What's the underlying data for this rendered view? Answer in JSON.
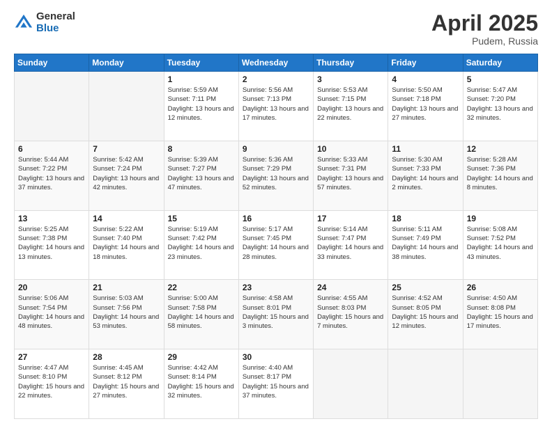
{
  "header": {
    "logo_general": "General",
    "logo_blue": "Blue",
    "title": "April 2025",
    "location": "Pudem, Russia"
  },
  "weekdays": [
    "Sunday",
    "Monday",
    "Tuesday",
    "Wednesday",
    "Thursday",
    "Friday",
    "Saturday"
  ],
  "weeks": [
    [
      {
        "day": "",
        "info": ""
      },
      {
        "day": "",
        "info": ""
      },
      {
        "day": "1",
        "info": "Sunrise: 5:59 AM\nSunset: 7:11 PM\nDaylight: 13 hours and 12 minutes."
      },
      {
        "day": "2",
        "info": "Sunrise: 5:56 AM\nSunset: 7:13 PM\nDaylight: 13 hours and 17 minutes."
      },
      {
        "day": "3",
        "info": "Sunrise: 5:53 AM\nSunset: 7:15 PM\nDaylight: 13 hours and 22 minutes."
      },
      {
        "day": "4",
        "info": "Sunrise: 5:50 AM\nSunset: 7:18 PM\nDaylight: 13 hours and 27 minutes."
      },
      {
        "day": "5",
        "info": "Sunrise: 5:47 AM\nSunset: 7:20 PM\nDaylight: 13 hours and 32 minutes."
      }
    ],
    [
      {
        "day": "6",
        "info": "Sunrise: 5:44 AM\nSunset: 7:22 PM\nDaylight: 13 hours and 37 minutes."
      },
      {
        "day": "7",
        "info": "Sunrise: 5:42 AM\nSunset: 7:24 PM\nDaylight: 13 hours and 42 minutes."
      },
      {
        "day": "8",
        "info": "Sunrise: 5:39 AM\nSunset: 7:27 PM\nDaylight: 13 hours and 47 minutes."
      },
      {
        "day": "9",
        "info": "Sunrise: 5:36 AM\nSunset: 7:29 PM\nDaylight: 13 hours and 52 minutes."
      },
      {
        "day": "10",
        "info": "Sunrise: 5:33 AM\nSunset: 7:31 PM\nDaylight: 13 hours and 57 minutes."
      },
      {
        "day": "11",
        "info": "Sunrise: 5:30 AM\nSunset: 7:33 PM\nDaylight: 14 hours and 2 minutes."
      },
      {
        "day": "12",
        "info": "Sunrise: 5:28 AM\nSunset: 7:36 PM\nDaylight: 14 hours and 8 minutes."
      }
    ],
    [
      {
        "day": "13",
        "info": "Sunrise: 5:25 AM\nSunset: 7:38 PM\nDaylight: 14 hours and 13 minutes."
      },
      {
        "day": "14",
        "info": "Sunrise: 5:22 AM\nSunset: 7:40 PM\nDaylight: 14 hours and 18 minutes."
      },
      {
        "day": "15",
        "info": "Sunrise: 5:19 AM\nSunset: 7:42 PM\nDaylight: 14 hours and 23 minutes."
      },
      {
        "day": "16",
        "info": "Sunrise: 5:17 AM\nSunset: 7:45 PM\nDaylight: 14 hours and 28 minutes."
      },
      {
        "day": "17",
        "info": "Sunrise: 5:14 AM\nSunset: 7:47 PM\nDaylight: 14 hours and 33 minutes."
      },
      {
        "day": "18",
        "info": "Sunrise: 5:11 AM\nSunset: 7:49 PM\nDaylight: 14 hours and 38 minutes."
      },
      {
        "day": "19",
        "info": "Sunrise: 5:08 AM\nSunset: 7:52 PM\nDaylight: 14 hours and 43 minutes."
      }
    ],
    [
      {
        "day": "20",
        "info": "Sunrise: 5:06 AM\nSunset: 7:54 PM\nDaylight: 14 hours and 48 minutes."
      },
      {
        "day": "21",
        "info": "Sunrise: 5:03 AM\nSunset: 7:56 PM\nDaylight: 14 hours and 53 minutes."
      },
      {
        "day": "22",
        "info": "Sunrise: 5:00 AM\nSunset: 7:58 PM\nDaylight: 14 hours and 58 minutes."
      },
      {
        "day": "23",
        "info": "Sunrise: 4:58 AM\nSunset: 8:01 PM\nDaylight: 15 hours and 3 minutes."
      },
      {
        "day": "24",
        "info": "Sunrise: 4:55 AM\nSunset: 8:03 PM\nDaylight: 15 hours and 7 minutes."
      },
      {
        "day": "25",
        "info": "Sunrise: 4:52 AM\nSunset: 8:05 PM\nDaylight: 15 hours and 12 minutes."
      },
      {
        "day": "26",
        "info": "Sunrise: 4:50 AM\nSunset: 8:08 PM\nDaylight: 15 hours and 17 minutes."
      }
    ],
    [
      {
        "day": "27",
        "info": "Sunrise: 4:47 AM\nSunset: 8:10 PM\nDaylight: 15 hours and 22 minutes."
      },
      {
        "day": "28",
        "info": "Sunrise: 4:45 AM\nSunset: 8:12 PM\nDaylight: 15 hours and 27 minutes."
      },
      {
        "day": "29",
        "info": "Sunrise: 4:42 AM\nSunset: 8:14 PM\nDaylight: 15 hours and 32 minutes."
      },
      {
        "day": "30",
        "info": "Sunrise: 4:40 AM\nSunset: 8:17 PM\nDaylight: 15 hours and 37 minutes."
      },
      {
        "day": "",
        "info": ""
      },
      {
        "day": "",
        "info": ""
      },
      {
        "day": "",
        "info": ""
      }
    ]
  ]
}
